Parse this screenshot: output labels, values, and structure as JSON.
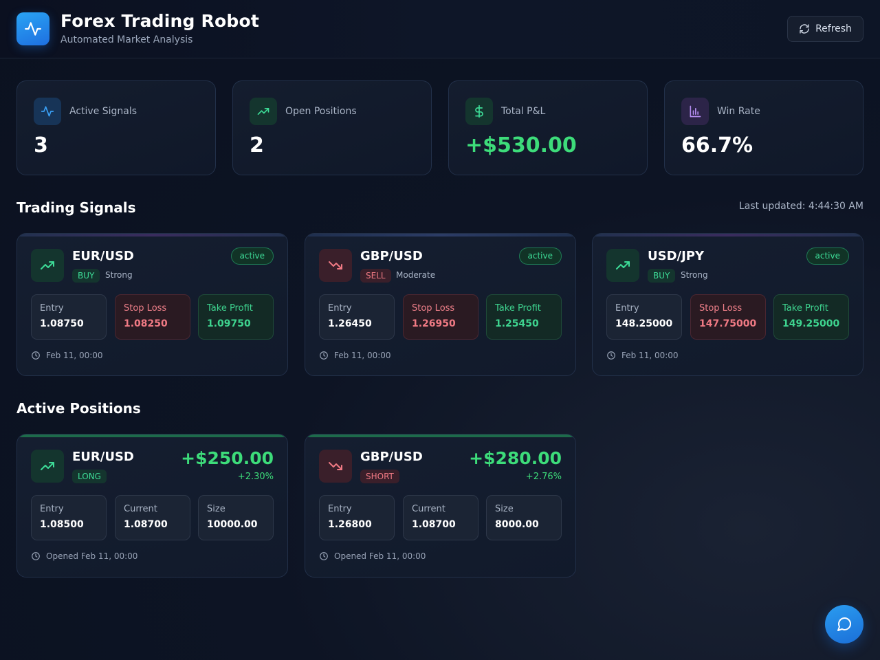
{
  "header": {
    "title": "Forex Trading Robot",
    "subtitle": "Automated Market Analysis",
    "refresh_label": "Refresh"
  },
  "stats": [
    {
      "label": "Active Signals",
      "value": "3",
      "icon": "activity-icon"
    },
    {
      "label": "Open Positions",
      "value": "2",
      "icon": "trending-up-icon"
    },
    {
      "label": "Total P&L",
      "value": "+$530.00",
      "icon": "dollar-icon"
    },
    {
      "label": "Win Rate",
      "value": "66.7%",
      "icon": "bar-chart-icon"
    }
  ],
  "signals_section": {
    "title": "Trading Signals",
    "last_updated": "Last updated: 4:44:30 AM"
  },
  "signals": [
    {
      "pair": "EUR/USD",
      "direction": "BUY",
      "strength": "Strong",
      "status": "active",
      "entry_label": "Entry",
      "entry": "1.08750",
      "sl_label": "Stop Loss",
      "sl": "1.08250",
      "tp_label": "Take Profit",
      "tp": "1.09750",
      "time": "Feb 11, 00:00"
    },
    {
      "pair": "GBP/USD",
      "direction": "SELL",
      "strength": "Moderate",
      "status": "active",
      "entry_label": "Entry",
      "entry": "1.26450",
      "sl_label": "Stop Loss",
      "sl": "1.26950",
      "tp_label": "Take Profit",
      "tp": "1.25450",
      "time": "Feb 11, 00:00"
    },
    {
      "pair": "USD/JPY",
      "direction": "BUY",
      "strength": "Strong",
      "status": "active",
      "entry_label": "Entry",
      "entry": "148.25000",
      "sl_label": "Stop Loss",
      "sl": "147.75000",
      "tp_label": "Take Profit",
      "tp": "149.25000",
      "time": "Feb 11, 00:00"
    }
  ],
  "positions_section": {
    "title": "Active Positions"
  },
  "positions": [
    {
      "pair": "EUR/USD",
      "side": "LONG",
      "pnl": "+$250.00",
      "pnl_pct": "+2.30%",
      "entry_label": "Entry",
      "entry": "1.08500",
      "current_label": "Current",
      "current": "1.08700",
      "size_label": "Size",
      "size": "10000.00",
      "opened": "Opened Feb 11, 00:00"
    },
    {
      "pair": "GBP/USD",
      "side": "SHORT",
      "pnl": "+$280.00",
      "pnl_pct": "+2.76%",
      "entry_label": "Entry",
      "entry": "1.26800",
      "current_label": "Current",
      "current": "1.08700",
      "size_label": "Size",
      "size": "8000.00",
      "opened": "Opened Feb 11, 00:00"
    }
  ],
  "colors": {
    "accent_blue": "#1e88e5",
    "positive": "#3ddc7a",
    "negative": "#f07a84"
  }
}
